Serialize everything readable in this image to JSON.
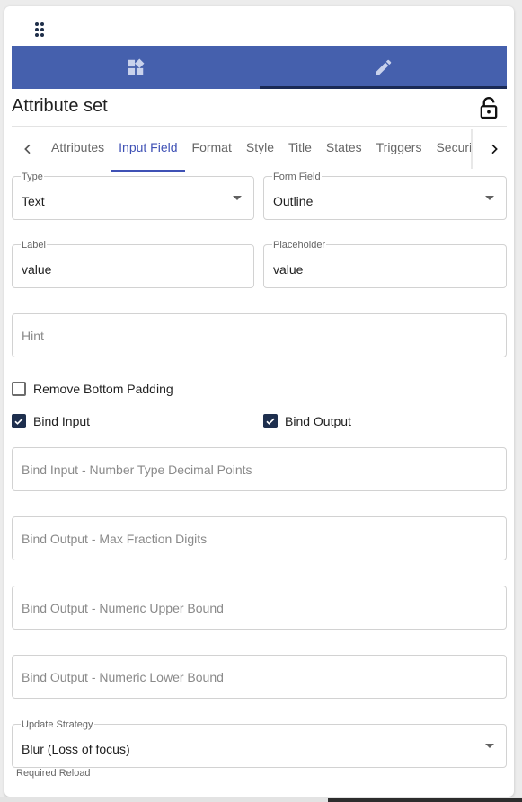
{
  "header": {
    "title": "Attribute set"
  },
  "toolbar": {
    "left_icon": "widgets-icon",
    "right_icon": "pencil-edit-icon",
    "selected": "edit"
  },
  "tabs": {
    "items": [
      {
        "label": "Attributes"
      },
      {
        "label": "Input Field"
      },
      {
        "label": "Format"
      },
      {
        "label": "Style"
      },
      {
        "label": "Title"
      },
      {
        "label": "States"
      },
      {
        "label": "Triggers"
      },
      {
        "label": "Security"
      }
    ],
    "active": "Input Field"
  },
  "form": {
    "type": {
      "label": "Type",
      "value": "Text"
    },
    "form_field": {
      "label": "Form Field",
      "value": "Outline"
    },
    "label_field": {
      "label": "Label",
      "value": "value"
    },
    "placeholder_field": {
      "label": "Placeholder",
      "value": "value"
    },
    "hint": {
      "placeholder": "Hint"
    },
    "remove_bottom_padding": {
      "label": "Remove Bottom Padding",
      "checked": false
    },
    "bind_input": {
      "label": "Bind Input",
      "checked": true
    },
    "bind_output": {
      "label": "Bind Output",
      "checked": true
    },
    "bind_input_decimal": {
      "placeholder": "Bind Input - Number Type Decimal Points"
    },
    "bind_output_max_fraction": {
      "placeholder": "Bind Output - Max Fraction Digits"
    },
    "bind_output_upper": {
      "placeholder": "Bind Output - Numeric Upper Bound"
    },
    "bind_output_lower": {
      "placeholder": "Bind Output - Numeric Lower Bound"
    },
    "update_strategy": {
      "label": "Update Strategy",
      "value": "Blur (Loss of focus)",
      "hint": "Required Reload"
    }
  },
  "colors": {
    "accent": "#4560ad",
    "active_tab": "#3f51b5",
    "checkbox": "#1e2f4e"
  }
}
